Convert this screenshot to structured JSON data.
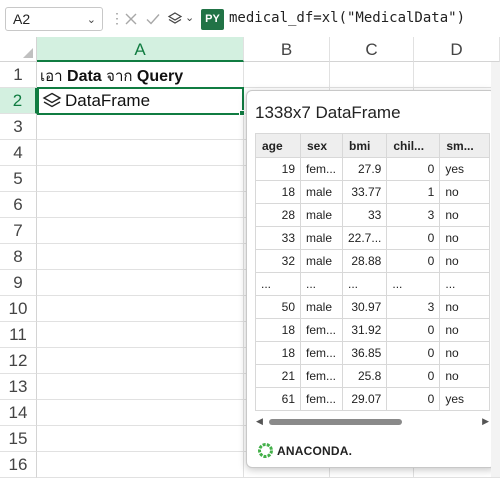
{
  "formula_bar": {
    "name_box": "A2",
    "py_badge": "PY",
    "formula": "medical_df=xl(\"MedicalData\")"
  },
  "columns": [
    "A",
    "B",
    "C",
    "D"
  ],
  "rows": [
    "1",
    "2",
    "3",
    "4",
    "5",
    "6",
    "7",
    "8",
    "9",
    "10",
    "11",
    "12",
    "13",
    "14",
    "15",
    "16"
  ],
  "cells": {
    "A1": {
      "thai_1": "เอา",
      "bold_1": "Data",
      "thai_2": "จาก",
      "bold_2": "Query"
    },
    "A2": "DataFrame"
  },
  "card": {
    "title": "1338x7 DataFrame",
    "headers": [
      "age",
      "sex",
      "bmi",
      "chil...",
      "sm..."
    ],
    "rows": [
      [
        "19",
        "fem...",
        "27.9",
        "0",
        "yes"
      ],
      [
        "18",
        "male",
        "33.77",
        "1",
        "no"
      ],
      [
        "28",
        "male",
        "33",
        "3",
        "no"
      ],
      [
        "33",
        "male",
        "22.7...",
        "0",
        "no"
      ],
      [
        "32",
        "male",
        "28.88",
        "0",
        "no"
      ],
      [
        "...",
        "...",
        "...",
        "...",
        "..."
      ],
      [
        "50",
        "male",
        "30.97",
        "3",
        "no"
      ],
      [
        "18",
        "fem...",
        "31.92",
        "0",
        "no"
      ],
      [
        "18",
        "fem...",
        "36.85",
        "0",
        "no"
      ],
      [
        "21",
        "fem...",
        "25.8",
        "0",
        "no"
      ],
      [
        "61",
        "fem...",
        "29.07",
        "0",
        "yes"
      ]
    ],
    "brand": "ANACONDA."
  },
  "colors": {
    "accent": "#107c41",
    "py_badge": "#217346",
    "anaconda": "#43b049"
  }
}
